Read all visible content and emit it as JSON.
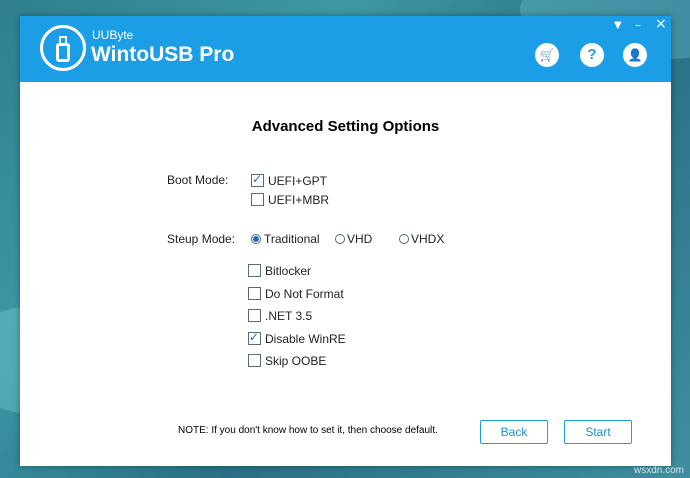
{
  "window": {
    "brand_small": "UUByte",
    "brand_big": "WintoUSB Pro",
    "controls": {
      "dropdown": "▼",
      "minimize": "–",
      "close": "×"
    },
    "header_buttons": [
      {
        "name": "cart-button",
        "icon": "cart-icon",
        "glyph": "🛒"
      },
      {
        "name": "help-button",
        "icon": "help-icon",
        "glyph": "?"
      },
      {
        "name": "account-button",
        "icon": "user-icon",
        "glyph": "👤"
      }
    ]
  },
  "page": {
    "title": "Advanced Setting Options",
    "boot_mode": {
      "label": "Boot Mode:",
      "options": [
        {
          "label": "UEFI+GPT",
          "checked": true
        },
        {
          "label": "UEFI+MBR",
          "checked": false
        }
      ]
    },
    "setup_mode": {
      "label": "Steup Mode:",
      "options": [
        {
          "label": "Traditional",
          "selected": true
        },
        {
          "label": "VHD",
          "selected": false
        },
        {
          "label": "VHDX",
          "selected": false
        }
      ]
    },
    "extra_options": [
      {
        "label": "Bitlocker",
        "checked": false
      },
      {
        "label": "Do Not Format",
        "checked": false
      },
      {
        "label": ".NET 3.5",
        "checked": false
      },
      {
        "label": "Disable WinRE",
        "checked": true
      },
      {
        "label": "Skip OOBE",
        "checked": false
      }
    ],
    "note": "NOTE: If you don't know how to set it, then choose default.",
    "back_label": "Back",
    "start_label": "Start"
  },
  "watermark": "wsxdn.com",
  "colors": {
    "accent": "#1b9ee6",
    "check": "#1b6fc4"
  }
}
